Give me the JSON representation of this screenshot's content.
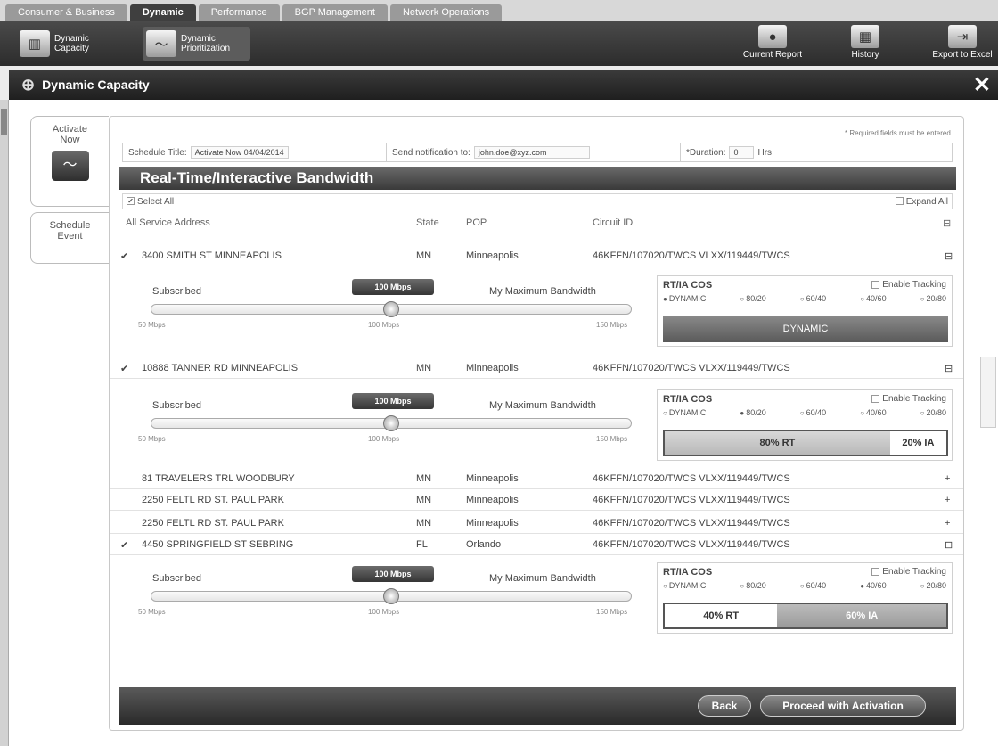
{
  "top_tabs": [
    "Consumer & Business",
    "Dynamic",
    "Performance",
    "BGP Management",
    "Network Operations"
  ],
  "toolbar": {
    "left": [
      {
        "label": "Dynamic Capacity",
        "icon": "gauge-icon"
      },
      {
        "label": "Dynamic Prioritization",
        "icon": "wave-icon"
      }
    ],
    "right": [
      {
        "label": "Current Report",
        "icon": "globe-icon"
      },
      {
        "label": "History",
        "icon": "grid-icon"
      },
      {
        "label": "Export to Excel",
        "icon": "export-icon"
      }
    ]
  },
  "window": {
    "title": "Dynamic Capacity",
    "close": "✕"
  },
  "side_tabs": [
    {
      "label": "Activate Now",
      "icon": "wave-icon"
    },
    {
      "label": "Schedule Event"
    }
  ],
  "panel": {
    "required_note": "* Required fields must be entered.",
    "schedule": {
      "title_label": "Schedule Title:",
      "title_value": "Activate Now 04/04/2014",
      "notify_label": "Send notification to:",
      "notify_value": "john.doe@xyz.com",
      "duration_label": "*Duration:",
      "duration_value": "0",
      "hrs": "Hrs"
    },
    "section_title": "Real-Time/Interactive Bandwidth",
    "select_all": "Select All",
    "expand_all": "Expand All",
    "columns": {
      "address": "All Service Address",
      "state": "State",
      "pop": "POP",
      "circuit": "Circuit ID"
    },
    "rows": [
      {
        "checked": "✔",
        "address": "3400 SMITH ST  MINNEAPOLIS",
        "state": "MN",
        "pop": "Minneapolis",
        "circuit": "46KFFN/107020/TWCS  VLXX/119449/TWCS",
        "toggle": "⊟"
      },
      {
        "checked": "✔",
        "address": "10888 TANNER RD  MINNEAPOLIS",
        "state": "MN",
        "pop": "Minneapolis",
        "circuit": "46KFFN/107020/TWCS  VLXX/119449/TWCS",
        "toggle": "⊟"
      },
      {
        "checked": "",
        "address": "81 TRAVELERS TRL  WOODBURY",
        "state": "MN",
        "pop": "Minneapolis",
        "circuit": "46KFFN/107020/TWCS  VLXX/119449/TWCS",
        "toggle": "+"
      },
      {
        "checked": "",
        "address": "2250 FELTL RD  ST. PAUL PARK",
        "state": "MN",
        "pop": "Minneapolis",
        "circuit": "46KFFN/107020/TWCS  VLXX/119449/TWCS",
        "toggle": "+"
      },
      {
        "checked": "",
        "address": "2250 FELTL RD  ST. PAUL PARK",
        "state": "MN",
        "pop": "Minneapolis",
        "circuit": "46KFFN/107020/TWCS  VLXX/119449/TWCS",
        "toggle": "+"
      },
      {
        "checked": "✔",
        "address": "4450 SPRINGFIELD ST  SEBRING",
        "state": "FL",
        "pop": "Orlando",
        "circuit": "46KFFN/107020/TWCS  VLXX/119449/TWCS",
        "toggle": "⊟"
      }
    ],
    "details": [
      {
        "subscribed": "Subscribed",
        "badge": "100 Mbps",
        "max": "My Maximum Bandwidth",
        "scale": [
          "50 Mbps",
          "100 Mbps",
          "150 Mbps"
        ],
        "slider_fraction": 0.5,
        "cos_title": "RT/IA COS",
        "enable_tracking": "Enable Tracking",
        "options": [
          {
            "label": "DYNAMIC",
            "selected": true
          },
          {
            "label": "80/20",
            "selected": false
          },
          {
            "label": "60/40",
            "selected": false
          },
          {
            "label": "40/60",
            "selected": false
          },
          {
            "label": "20/80",
            "selected": false
          }
        ],
        "bar_type": "full",
        "bar_label": "DYNAMIC"
      },
      {
        "subscribed": "Subscribed",
        "badge": "100 Mbps",
        "max": "My Maximum Bandwidth",
        "scale": [
          "50 Mbps",
          "100 Mbps",
          "150 Mbps"
        ],
        "slider_fraction": 0.5,
        "cos_title": "RT/IA COS",
        "enable_tracking": "Enable Tracking",
        "options": [
          {
            "label": "DYNAMIC",
            "selected": false
          },
          {
            "label": "80/20",
            "selected": true
          },
          {
            "label": "60/40",
            "selected": false
          },
          {
            "label": "40/60",
            "selected": false
          },
          {
            "label": "20/80",
            "selected": false
          }
        ],
        "bar_type": "split",
        "rt_label": "80% RT",
        "ia_label": "20% IA",
        "rt_fraction": 0.8
      },
      {
        "subscribed": "Subscribed",
        "badge": "100 Mbps",
        "max": "My Maximum Bandwidth",
        "scale": [
          "50 Mbps",
          "100 Mbps",
          "150 Mbps"
        ],
        "slider_fraction": 0.5,
        "cos_title": "RT/IA COS",
        "enable_tracking": "Enable Tracking",
        "options": [
          {
            "label": "DYNAMIC",
            "selected": false
          },
          {
            "label": "80/20",
            "selected": false
          },
          {
            "label": "60/40",
            "selected": false
          },
          {
            "label": "40/60",
            "selected": true
          },
          {
            "label": "20/80",
            "selected": false
          }
        ],
        "bar_type": "split",
        "rt_label": "40% RT",
        "ia_label": "60% IA",
        "rt_fraction": 0.4
      }
    ],
    "buttons": {
      "back": "Back",
      "proceed": "Proceed with Activation"
    }
  }
}
